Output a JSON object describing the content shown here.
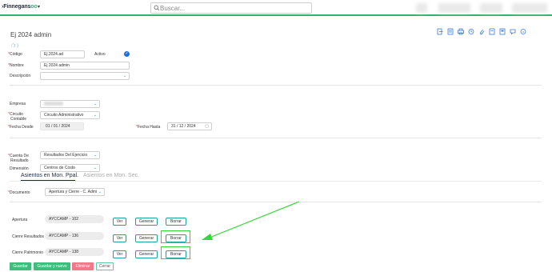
{
  "header": {
    "logo_text": "Finnegans",
    "logo_suffix": "oo",
    "search_placeholder": "Buscar..."
  },
  "record": {
    "title": "Ej 2024 admin"
  },
  "toolbar": {
    "icons": [
      "export-icon",
      "print-icon",
      "print-alt-icon",
      "history-icon",
      "attach-icon",
      "link-icon",
      "copy-icon",
      "comment-icon",
      "help-icon"
    ]
  },
  "form": {
    "codigo_label": "Código",
    "codigo_value": "Ej.2024.ad",
    "activo_label": "Activo",
    "nombre_label": "Nombre",
    "nombre_value": "Ej 2024 admin",
    "descripcion_label": "Descripción",
    "descripcion_value": "",
    "empresa_label": "Empresa",
    "empresa_value": "",
    "circuito_label_1": "Circuito",
    "circuito_label_2": "Contable",
    "circuito_value": "Circuito Administrativo",
    "fecha_desde_label": "Fecha Desde",
    "fecha_desde_value": "01 / 01 / 2024",
    "fecha_hasta_label": "Fecha Hasta",
    "fecha_hasta_value": "31 / 12 / 2024",
    "cuenta_label_1": "Cuenta De",
    "cuenta_label_2": "Resultado",
    "cuenta_value": "Resultados Del Ejercicio",
    "dimension_label": "Dimensión",
    "dimension_value": "Centros de Costo"
  },
  "tabs": {
    "active": "Asientos en Mon. Ppal.",
    "inactive": "Asientos en Mon. Sec."
  },
  "asientos": {
    "documento_label": "Documento",
    "documento_value": "Apertura y Cierre - C. Admi",
    "rows": [
      {
        "label": "Apertura",
        "value": "AYCCAMP - 102",
        "ver": "Ver",
        "generar": "Generar",
        "borrar": "Borrar"
      },
      {
        "label": "Cierre Resultados",
        "value": "AYCCAMP - 136",
        "ver": "Ver",
        "generar": "Generar",
        "borrar": "Borrar"
      },
      {
        "label": "Cierre Patrimonio",
        "value": "AYCCAMP - 138",
        "ver": "Ver",
        "generar": "Generar",
        "borrar": "Borrar"
      }
    ]
  },
  "footer": {
    "guardar": "Guardar",
    "guardar_nuevo": "Guardar y nuevo",
    "eliminar": "Eliminar",
    "cerrar": "Cerrar"
  },
  "colors": {
    "brand_green": "#2fb56b",
    "teal": "#1aa39a",
    "highlight": "#32d836",
    "danger": "#f07a8a"
  }
}
